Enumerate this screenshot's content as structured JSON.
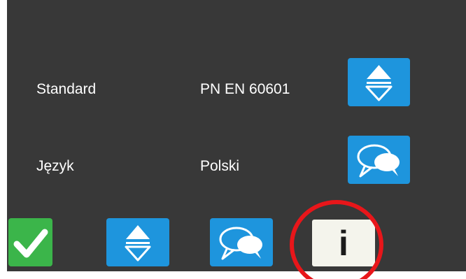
{
  "settings": {
    "standard": {
      "label": "Standard",
      "value": "PN EN 60601",
      "button_icon": "up-down-arrows-icon"
    },
    "language": {
      "label": "Język",
      "value": "Polski",
      "button_icon": "speech-bubbles-icon"
    }
  },
  "toolbar": {
    "buttons": [
      {
        "name": "confirm",
        "icon": "checkmark-icon",
        "color": "#3bb54a"
      },
      {
        "name": "standard",
        "icon": "up-down-arrows-icon",
        "color": "#1e95dd"
      },
      {
        "name": "language",
        "icon": "speech-bubbles-icon",
        "color": "#1e95dd"
      },
      {
        "name": "info",
        "icon": "info-icon",
        "label": "i",
        "color": "#f4f4ec"
      }
    ]
  },
  "annotation": {
    "shape": "circle",
    "color": "#e8161a",
    "target": "info"
  },
  "colors": {
    "screen_background": "#383838",
    "text": "#ffffff",
    "accent_blue": "#1e95dd",
    "accent_green": "#3bb54a"
  }
}
